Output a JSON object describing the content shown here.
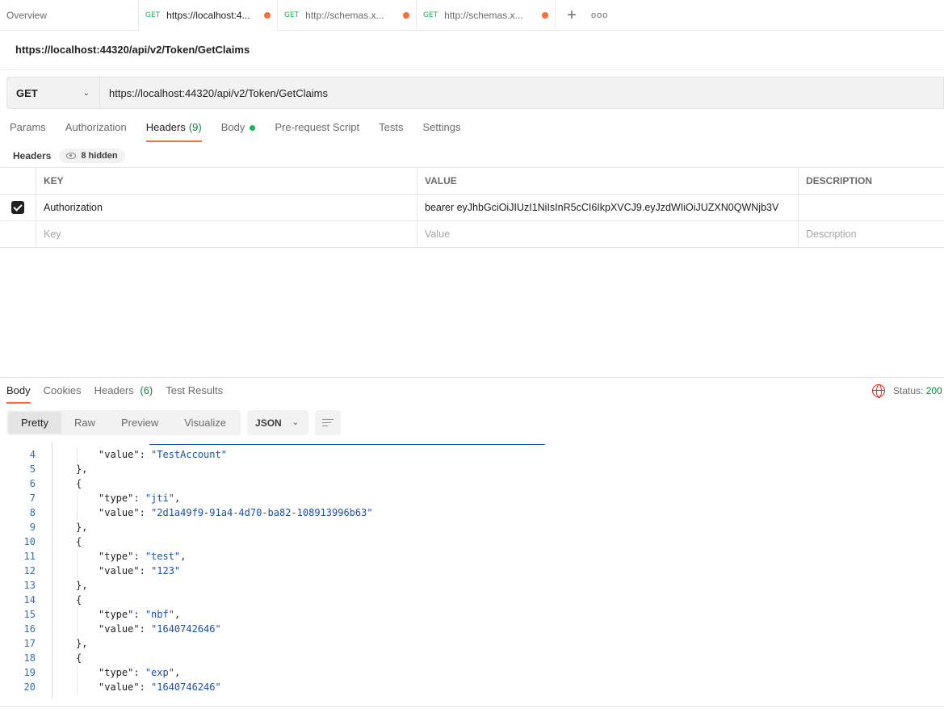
{
  "tabs": {
    "overview": "Overview",
    "items": [
      {
        "method": "GET",
        "title": "https://localhost:4..."
      },
      {
        "method": "GET",
        "title": "http://schemas.x..."
      },
      {
        "method": "GET",
        "title": "http://schemas.x..."
      }
    ],
    "plus": "+",
    "more": "ooo"
  },
  "request": {
    "title": "https://localhost:44320/api/v2/Token/GetClaims",
    "method": "GET",
    "url": "https://localhost:44320/api/v2/Token/GetClaims"
  },
  "request_tabs": {
    "params": "Params",
    "authorization": "Authorization",
    "headers": "Headers",
    "headers_count": "(9)",
    "body": "Body",
    "prerequest": "Pre-request Script",
    "tests": "Tests",
    "settings": "Settings"
  },
  "headers_section": {
    "label": "Headers",
    "hidden": "8 hidden"
  },
  "headers_table": {
    "columns": {
      "key": "KEY",
      "value": "VALUE",
      "description": "DESCRIPTION"
    },
    "rows": [
      {
        "key": "Authorization",
        "value": "bearer eyJhbGciOiJIUzI1NiIsInR5cCI6IkpXVCJ9.eyJzdWIiOiJUZXN0QWNjb3V",
        "description": ""
      }
    ],
    "placeholders": {
      "key": "Key",
      "value": "Value",
      "description": "Description"
    }
  },
  "response_tabs": {
    "body": "Body",
    "cookies": "Cookies",
    "headers": "Headers",
    "headers_count": "(6)",
    "test_results": "Test Results"
  },
  "status": {
    "label": "Status:",
    "value": "200"
  },
  "view": {
    "modes": [
      "Pretty",
      "Raw",
      "Preview",
      "Visualize"
    ],
    "active_mode": "Pretty",
    "format": "JSON"
  },
  "code_lines": [
    {
      "n": "4",
      "text": "\"value\": \"TestAccount\""
    },
    {
      "n": "5",
      "text": "},"
    },
    {
      "n": "6",
      "text": "{"
    },
    {
      "n": "7",
      "text": "\"type\": \"jti\","
    },
    {
      "n": "8",
      "text": "\"value\": \"2d1a49f9-91a4-4d70-ba82-108913996b63\""
    },
    {
      "n": "9",
      "text": "},"
    },
    {
      "n": "10",
      "text": "{"
    },
    {
      "n": "11",
      "text": "\"type\": \"test\","
    },
    {
      "n": "12",
      "text": "\"value\": \"123\""
    },
    {
      "n": "13",
      "text": "},"
    },
    {
      "n": "14",
      "text": "{"
    },
    {
      "n": "15",
      "text": "\"type\": \"nbf\","
    },
    {
      "n": "16",
      "text": "\"value\": \"1640742646\""
    },
    {
      "n": "17",
      "text": "},"
    },
    {
      "n": "18",
      "text": "{"
    },
    {
      "n": "19",
      "text": "\"type\": \"exp\","
    },
    {
      "n": "20",
      "text": "\"value\": \"1640746246\""
    }
  ],
  "colors": {
    "accent": "#ff6c37",
    "method_green": "#0cbb52",
    "status_green": "#0a8a3d",
    "json_blue": "#1f4ea8"
  }
}
